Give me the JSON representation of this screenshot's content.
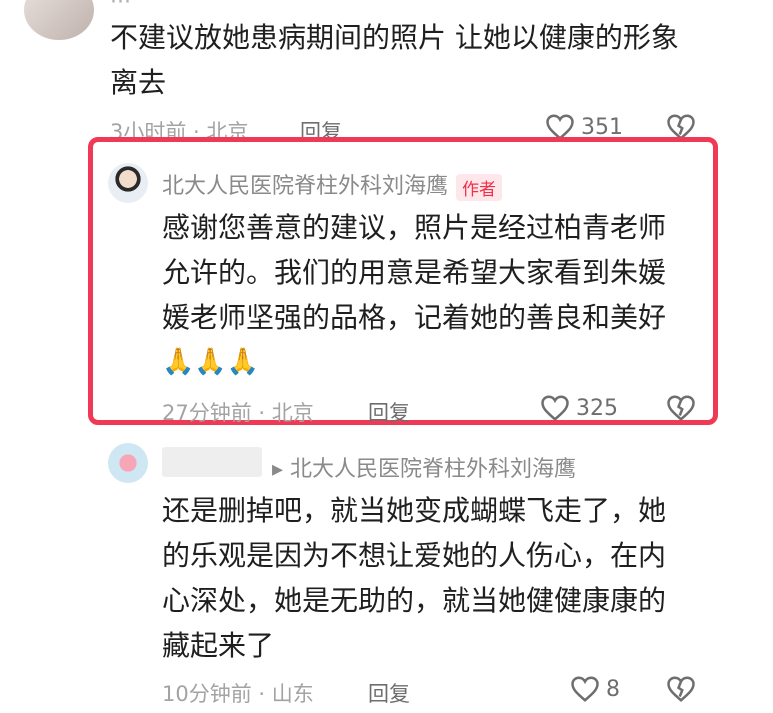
{
  "comment_top": {
    "text_line1": "不建议放她患病期间的照片 让她以健康的形象",
    "text_line2": "离去",
    "meta": "3小时前 · 北京",
    "reply": "回复",
    "likes": "351"
  },
  "comment_author": {
    "name": "北大人民医院脊柱外科刘海鹰",
    "badge": "作者",
    "lines": [
      "感谢您善意的建议，照片是经过柏青老师",
      "允许的。我们的用意是希望大家看到朱媛",
      "媛老师坚强的品格，记着她的善良和美好",
      "🙏🙏🙏"
    ],
    "meta": "27分钟前 · 北京",
    "reply": "回复",
    "likes": "325"
  },
  "comment_reply": {
    "reply_to": "▸ 北大人民医院脊柱外科刘海鹰",
    "lines": [
      "还是删掉吧，就当她变成蝴蝶飞走了，她",
      "的乐观是因为不想让爱她的人伤心，在内",
      "心深处，她是无助的，就当她健健康康的",
      "藏起来了"
    ],
    "meta": "10分钟前 · 山东",
    "reply": "回复",
    "likes": "8"
  },
  "colors": {
    "highlight": "#f03a55",
    "badge_text": "#f0304a",
    "badge_bg": "#fde7ea"
  },
  "icons": [
    "heart-icon",
    "broken-heart-icon",
    "avatar-image"
  ]
}
